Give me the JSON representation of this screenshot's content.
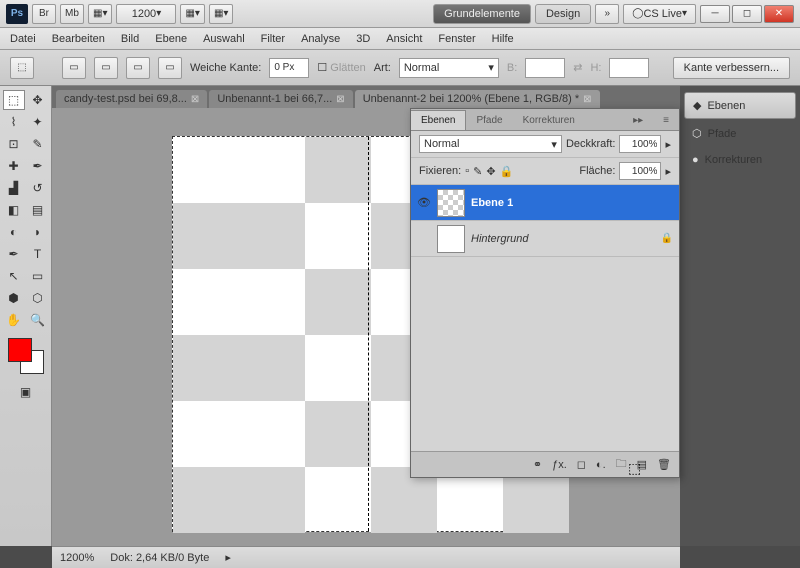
{
  "title": {
    "ps": "Ps",
    "br": "Br",
    "mb": "Mb",
    "zoom": "1200",
    "ws_active": "Grundelemente",
    "ws_other": "Design",
    "cslive": "CS Live"
  },
  "menu": [
    "Datei",
    "Bearbeiten",
    "Bild",
    "Ebene",
    "Auswahl",
    "Filter",
    "Analyse",
    "3D",
    "Ansicht",
    "Fenster",
    "Hilfe"
  ],
  "options": {
    "feather_label": "Weiche Kante:",
    "feather_val": "0 Px",
    "glatten": "Glätten",
    "art": "Art:",
    "art_val": "Normal",
    "b": "B:",
    "h": "H:",
    "refine": "Kante verbessern..."
  },
  "tabs": [
    {
      "label": "candy-test.psd bei 69,8...",
      "active": false
    },
    {
      "label": "Unbenannt-1 bei 66,7...",
      "active": false
    },
    {
      "label": "Unbenannt-2 bei 1200% (Ebene 1, RGB/8) *",
      "active": true
    }
  ],
  "panel": {
    "tabs": [
      "Ebenen",
      "Pfade",
      "Korrekturen"
    ],
    "blend": "Normal",
    "opacity_label": "Deckkraft:",
    "opacity": "100%",
    "fix_label": "Fixieren:",
    "fill_label": "Fläche:",
    "fill": "100%"
  },
  "layers": [
    {
      "name": "Ebene 1",
      "sel": true,
      "trans": true,
      "vis": true,
      "lock": false
    },
    {
      "name": "Hintergrund",
      "sel": false,
      "trans": false,
      "vis": false,
      "lock": true
    }
  ],
  "rightdock": [
    {
      "label": "Ebenen",
      "active": true
    },
    {
      "label": "Pfade",
      "active": false
    },
    {
      "label": "Korrekturen",
      "active": false
    }
  ],
  "status": {
    "zoom": "1200%",
    "doc": "Dok: 2,64 KB/0 Byte"
  }
}
